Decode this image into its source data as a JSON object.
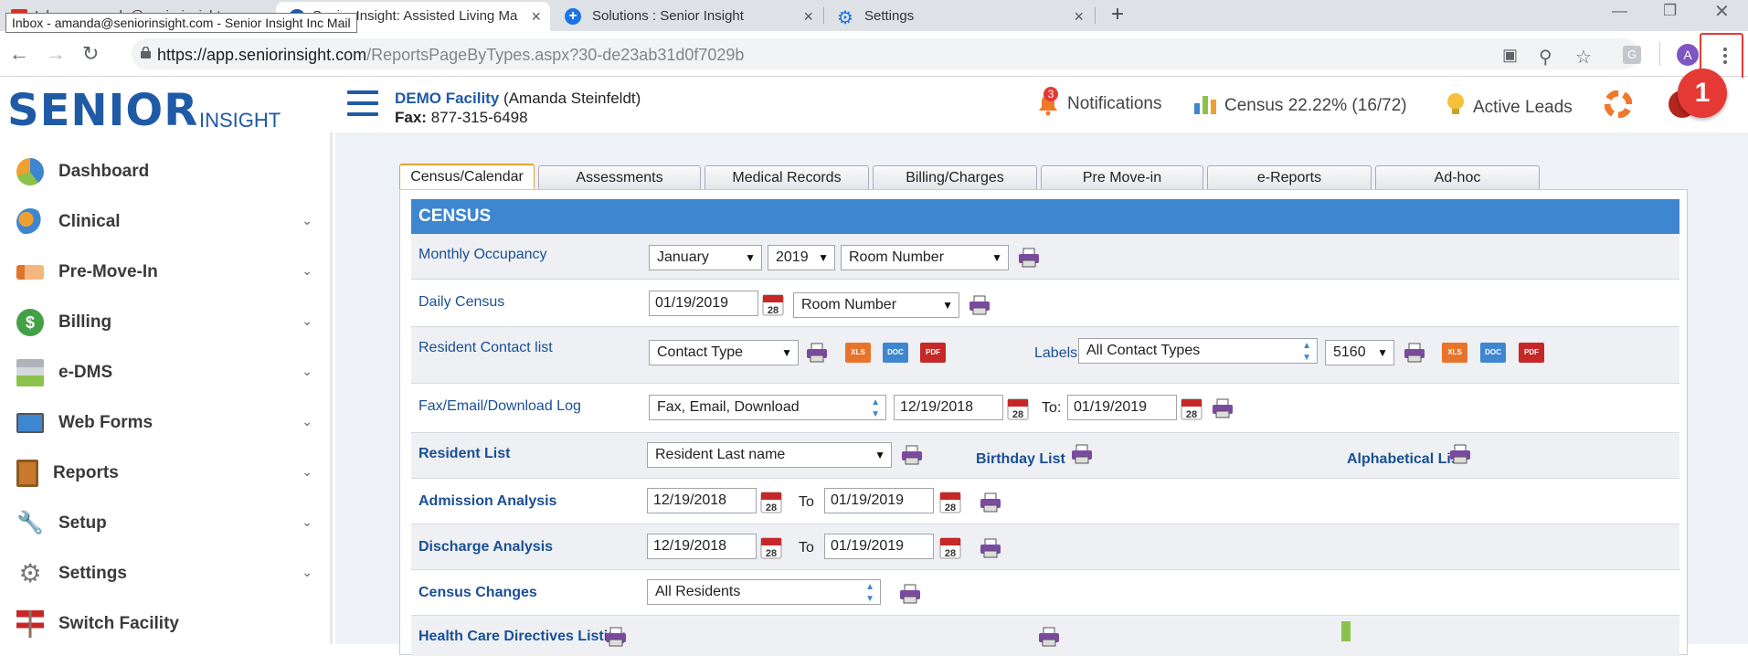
{
  "browser": {
    "tooltip": "Inbox - amanda@seniorinsight.com - Senior Insight Inc Mail",
    "tabs": [
      {
        "label": "Inbox - amanda@seniorinsight...",
        "icon": "gmail-icon"
      },
      {
        "label": "Senior Insight: Assisted Living Ma",
        "icon": "site-icon"
      },
      {
        "label": "Solutions : Senior Insight",
        "icon": "plus-circle-icon"
      },
      {
        "label": "Settings",
        "icon": "gear-icon"
      }
    ],
    "new_tab": "+",
    "url_host": "https://app.seniorinsight.com",
    "url_path": "/ReportsPageByTypes.aspx?30-de23ab31d0f7029b",
    "avatar_letter": "A",
    "step_badge": "1"
  },
  "header": {
    "logo_main": "SENIOR",
    "logo_sub": "INSIGHT",
    "facility_name": "DEMO Facility",
    "facility_owner": "(Amanda Steinfeldt)",
    "fax_label": "Fax:",
    "fax_number": "877-315-6498",
    "notifications_label": "Notifications",
    "notifications_count": "3",
    "census_label": "Census 22.22% (16/72)",
    "leads_label": "Active Leads"
  },
  "sidebar": {
    "items": [
      {
        "label": "Dashboard",
        "icon": "dashboard-icon",
        "chevron": false
      },
      {
        "label": "Clinical",
        "icon": "clinical-icon",
        "chevron": true
      },
      {
        "label": "Pre-Move-In",
        "icon": "bed-icon",
        "chevron": true
      },
      {
        "label": "Billing",
        "icon": "dollar-icon",
        "chevron": true
      },
      {
        "label": "e-DMS",
        "icon": "documents-icon",
        "chevron": true
      },
      {
        "label": "Web Forms",
        "icon": "monitor-icon",
        "chevron": true
      },
      {
        "label": "Reports",
        "icon": "clipboard-icon",
        "chevron": true
      },
      {
        "label": "Setup",
        "icon": "wrench-icon",
        "chevron": true
      },
      {
        "label": "Settings",
        "icon": "settings-gear-icon",
        "chevron": true
      },
      {
        "label": "Switch Facility",
        "icon": "signpost-icon",
        "chevron": false
      }
    ]
  },
  "tabs": [
    "Census/Calendar",
    "Assessments",
    "Medical Records",
    "Billing/Charges",
    "Pre Move-in",
    "e-Reports",
    "Ad-hoc"
  ],
  "census": {
    "heading": "CENSUS",
    "monthly_occupancy": {
      "label": "Monthly Occupancy",
      "month": "January",
      "year": "2019",
      "sort": "Room Number"
    },
    "daily_census": {
      "label": "Daily Census",
      "date": "01/19/2019",
      "cal_day": "28",
      "sort": "Room Number"
    },
    "resident_contact": {
      "label": "Resident Contact list",
      "contact_type": "Contact Type",
      "labels_label": "Labels",
      "labels_value": "All Contact Types",
      "label_size": "5160",
      "xls": "XLS",
      "doc": "DOC",
      "pdf": "PDF"
    },
    "fax_log": {
      "label": "Fax/Email/Download Log",
      "type": "Fax, Email, Download",
      "from": "12/19/2018",
      "to_label": "To:",
      "to": "01/19/2019"
    },
    "resident_list": {
      "label": "Resident List",
      "sort": "Resident Last name",
      "birthday": "Birthday List",
      "alpha": "Alphabetical List"
    },
    "admission": {
      "label": "Admission Analysis",
      "from": "12/19/2018",
      "to_label": "To",
      "to": "01/19/2019"
    },
    "discharge": {
      "label": "Discharge Analysis",
      "from": "12/19/2018",
      "to_label": "To",
      "to": "01/19/2019"
    },
    "census_changes": {
      "label": "Census Changes",
      "value": "All Residents"
    },
    "health_care": {
      "label": "Health Care Directives Listing"
    }
  }
}
